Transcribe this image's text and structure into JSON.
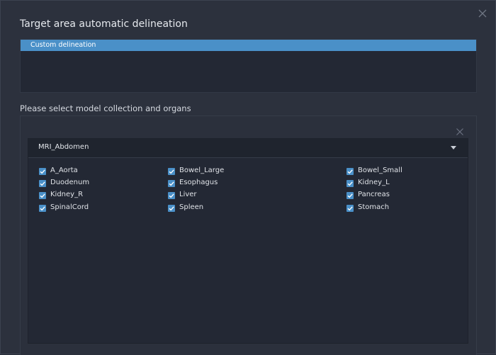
{
  "dialog": {
    "title": "Target area automatic delineation"
  },
  "delineation": {
    "items": [
      {
        "label": "Custom delineation",
        "selected": true
      }
    ]
  },
  "model_section": {
    "label": "Please select model collection and organs",
    "collection": {
      "selected": "MRI_Abdomen"
    },
    "organs": [
      {
        "label": "A_Aorta",
        "checked": true
      },
      {
        "label": "Duodenum",
        "checked": true
      },
      {
        "label": "Kidney_R",
        "checked": true
      },
      {
        "label": "SpinalCord",
        "checked": true
      },
      {
        "label": "Bowel_Large",
        "checked": true
      },
      {
        "label": "Esophagus",
        "checked": true
      },
      {
        "label": "Liver",
        "checked": true
      },
      {
        "label": "Spleen",
        "checked": true
      },
      {
        "label": "Bowel_Small",
        "checked": true
      },
      {
        "label": "Kidney_L",
        "checked": true
      },
      {
        "label": "Pancreas",
        "checked": true
      },
      {
        "label": "Stomach",
        "checked": true
      }
    ]
  },
  "colors": {
    "accent": "#4a90c8",
    "background": "#2c313d",
    "panel": "#232834"
  },
  "icons": {
    "close": "close-icon",
    "dropdown": "chevron-down-icon",
    "checkbox": "checkbox-checked-icon"
  }
}
